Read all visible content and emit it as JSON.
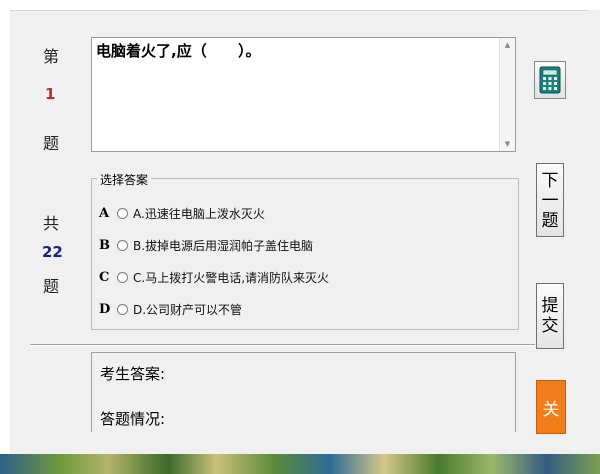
{
  "left_panel": {
    "question_prefix": "第",
    "question_number": "1",
    "question_suffix": "题",
    "total_prefix": "共",
    "total_count": "22",
    "total_suffix": "题"
  },
  "question": {
    "text": "电脑着火了,应（      ）。"
  },
  "answers_group": {
    "title": "选择答案",
    "options": [
      {
        "letter": "A",
        "text": "A.迅速往电脑上泼水灭火"
      },
      {
        "letter": "B",
        "text": "B.拔掉电源后用湿润帕子盖住电脑"
      },
      {
        "letter": "C",
        "text": "C.马上拨打火警电话,请消防队来灭火"
      },
      {
        "letter": "D",
        "text": "D.公司财产可以不管"
      }
    ]
  },
  "result": {
    "candidate_answer_label": "考生答案:",
    "answer_status_label": "答题情况:"
  },
  "buttons": {
    "next_line1": "下",
    "next_line2": "一",
    "next_line3": "题",
    "submit_line1": "提",
    "submit_line2": "交",
    "close_label": "关"
  },
  "colors": {
    "question_number": "#c0282c",
    "total_count": "#1a237e",
    "close_button": "#f07d1a"
  },
  "icons": {
    "calculator": "calculator-icon"
  }
}
